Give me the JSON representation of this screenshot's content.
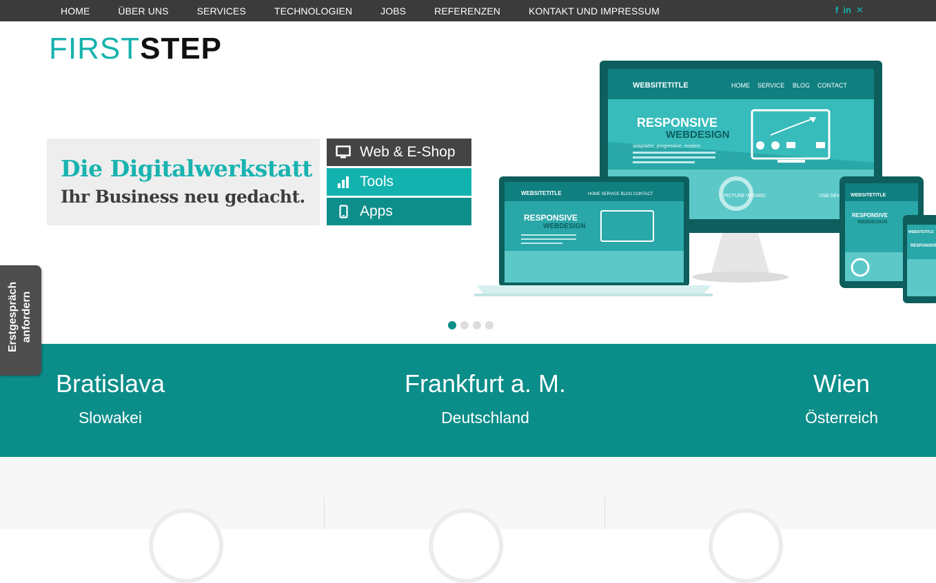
{
  "nav": {
    "items": [
      "HOME",
      "ÜBER UNS",
      "SERVICES",
      "TECHNOLOGIEN",
      "JOBS",
      "REFERENZEN",
      "KONTAKT UND IMPRESSUM"
    ],
    "social": [
      {
        "icon": "facebook-icon",
        "glyph": "f"
      },
      {
        "icon": "linkedin-icon",
        "glyph": "in"
      },
      {
        "icon": "xing-icon",
        "glyph": "✕"
      }
    ]
  },
  "logo": {
    "part1": "FIRST",
    "part2": "STEP"
  },
  "hero": {
    "headline": "Die Digitalwerkstatt",
    "subline": "Ihr Business neu gedacht.",
    "services": [
      {
        "label": "Web & E-Shop",
        "icon": "monitor-icon"
      },
      {
        "label": "Tools",
        "icon": "bar-chart-icon"
      },
      {
        "label": "Apps",
        "icon": "smartphone-icon"
      }
    ]
  },
  "illustration": {
    "site_title": "WEBSITETITLE",
    "menu": [
      "HOME",
      "SERVICE",
      "BLOG",
      "CONTACT"
    ],
    "banner1": "RESPONSIVE",
    "banner2": "WEBDESIGN",
    "tagline": "adaptable, progressive, modern",
    "feature1": "PICTURE WIZARD",
    "feature2": "USB DEVICE"
  },
  "carousel": {
    "count": 4,
    "active": 0
  },
  "cities": [
    {
      "name": "Bratislava",
      "country": "Slowakei"
    },
    {
      "name": "Frankfurt a. M.",
      "country": "Deutschland"
    },
    {
      "name": "Wien",
      "country": "Österreich"
    }
  ],
  "sidetab": {
    "line1": "Erstgespräch",
    "line2": "anfordern"
  },
  "colors": {
    "accent": "#12b3ae",
    "accent_dark": "#0b8d89",
    "nav_bg": "#3b3b3b"
  }
}
